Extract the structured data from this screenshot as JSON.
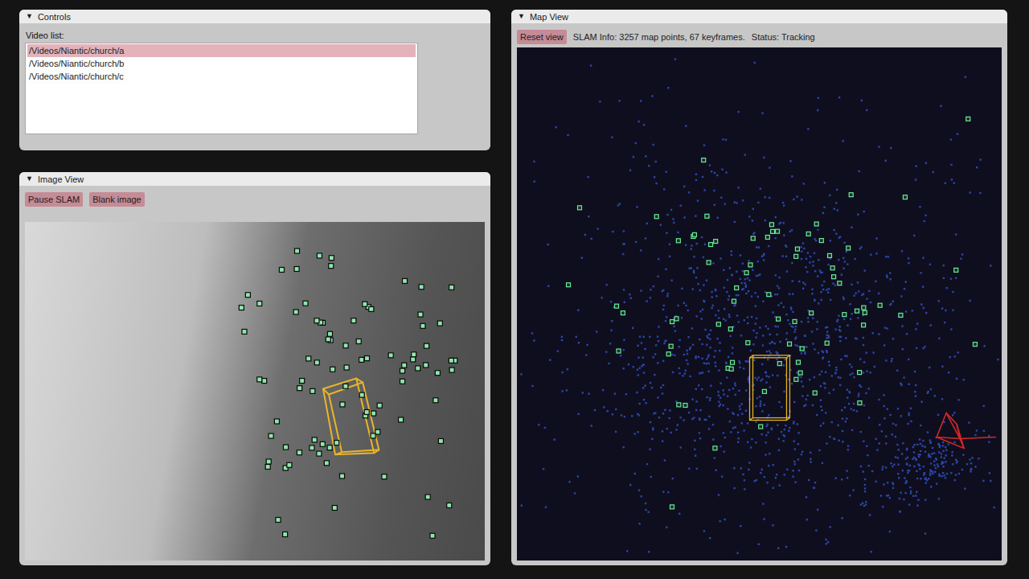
{
  "controls": {
    "title": "Controls",
    "toggle_icon": "▼",
    "expanded": true,
    "list_label": "Video list:",
    "videos": [
      {
        "label": "/Videos/Niantic/church/a",
        "selected": true
      },
      {
        "label": "/Videos/Niantic/church/b",
        "selected": false
      },
      {
        "label": "/Videos/Niantic/church/c",
        "selected": false
      }
    ]
  },
  "image_view": {
    "title": "Image View",
    "toggle_icon": "▼",
    "expanded": true,
    "buttons": [
      "Pause SLAM",
      "Blank image"
    ]
  },
  "map_view": {
    "title": "Map View",
    "toggle_icon": "▼",
    "expanded": true,
    "buttons": [
      "Reset view"
    ],
    "info": "SLAM Info: 3257 map points, 67 keyframes.",
    "status": "Status: Tracking"
  }
}
